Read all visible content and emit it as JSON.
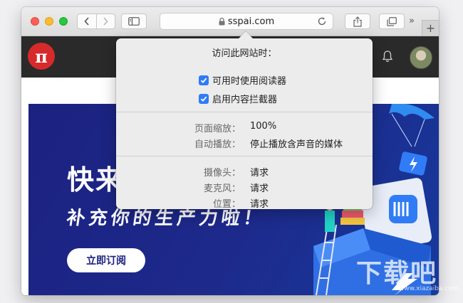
{
  "browser": {
    "url": "sspai.com",
    "icons": {
      "back": "chevron-left-icon",
      "forward": "chevron-right-icon",
      "sidebar": "sidebar-icon",
      "lock": "lock-icon",
      "reload": "reload-icon",
      "share": "share-icon",
      "tabs": "tabs-icon",
      "more": "double-chevron-icon",
      "new_tab": "plus-icon"
    },
    "more_glyph": "»",
    "new_tab_glyph": "+"
  },
  "popover": {
    "title": "访问此网站时：",
    "options": [
      {
        "label": "可用时使用阅读器",
        "checked": true
      },
      {
        "label": "启用内容拦截器",
        "checked": true
      }
    ],
    "settings": [
      {
        "label": "页面缩放：",
        "value": "100%"
      },
      {
        "label": "自动播放：",
        "value": "停止播放含声音的媒体"
      }
    ],
    "permissions": [
      {
        "label": "摄像头：",
        "value": "请求"
      },
      {
        "label": "麦克风：",
        "value": "请求"
      },
      {
        "label": "位置：",
        "value": "请求"
      }
    ]
  },
  "site": {
    "logo_glyph": "π",
    "banner": {
      "headline": "快来",
      "subline": "补充你的生产力啦！",
      "button": "立即订阅"
    }
  },
  "watermark": {
    "text": "下载吧",
    "url": "www.xiazaiba.com"
  },
  "colors": {
    "accent": "#2f7cf6",
    "logo": "#d72a2a",
    "banner": "#1b2180",
    "header": "#2a2a2a"
  }
}
